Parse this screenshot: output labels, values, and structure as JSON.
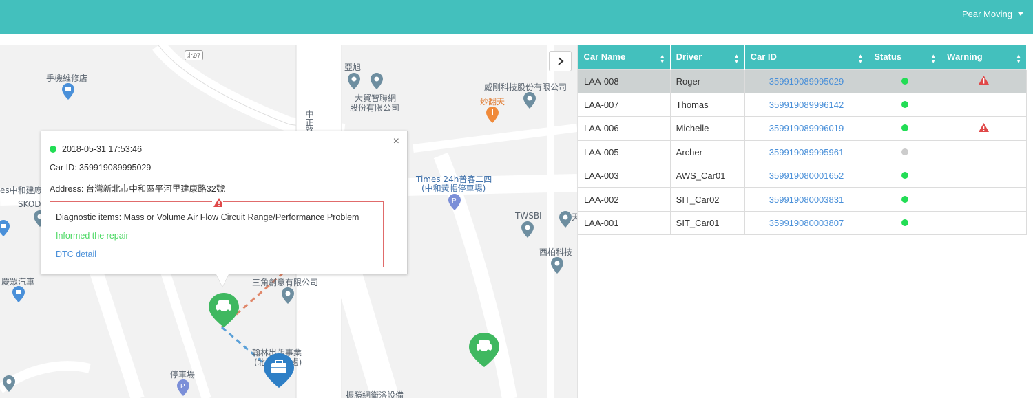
{
  "header": {
    "user_name": "Pear Moving",
    "color": "#43c0bd"
  },
  "map": {
    "labels": {
      "road_shield": "北97",
      "phone_shop": "手機維修店",
      "yaxu": "亞旭",
      "trade_net_1": "大貿智聯網",
      "trade_net_2": "股份有限公司",
      "weigang": "威剛科技股份有限公司",
      "chaofan": "炒翻天",
      "road_vertical": "中正路",
      "times_1": "Times 24h普客二四",
      "times_2": "(中和黃帽停車場)",
      "twsbi": "TWSBI",
      "xibo": "西柏科技",
      "sanjiao": "三角創意有限公司",
      "hanlin_1": "翰林出版事業",
      "hanlin_2": "(北區營運處)",
      "parking": "停車場",
      "zhensheng": "振勝網衛浴設備",
      "chunghe_left": "es中和建廠",
      "skoda": "SKOD",
      "qingzhong": "慶眾汽車",
      "partial_right": "天"
    }
  },
  "popup": {
    "datetime": "2018-05-31 17:53:46",
    "car_id": "Car ID: 359919089995029",
    "address": "Address: 台灣新北市中和區平河里建康路32號",
    "diagnostic": "Diagnostic items: Mass or Volume Air Flow Circuit Range/Performance Problem",
    "informed": "Informed the repair",
    "dtc_link": "DTC detail",
    "close_glyph": "×"
  },
  "table": {
    "columns": [
      "Car Name",
      "Driver",
      "Car ID",
      "Status",
      "Warning"
    ],
    "rows": [
      {
        "name": "LAA-008",
        "driver": "Roger",
        "car_id": "359919089995029",
        "status": "online",
        "warning": true
      },
      {
        "name": "LAA-007",
        "driver": "Thomas",
        "car_id": "359919089996142",
        "status": "online",
        "warning": false
      },
      {
        "name": "LAA-006",
        "driver": "Michelle",
        "car_id": "359919089996019",
        "status": "online",
        "warning": true
      },
      {
        "name": "LAA-005",
        "driver": "Archer",
        "car_id": "359919089995961",
        "status": "offline",
        "warning": false
      },
      {
        "name": "LAA-003",
        "driver": "AWS_Car01",
        "car_id": "359919080001652",
        "status": "online",
        "warning": false
      },
      {
        "name": "LAA-002",
        "driver": "SIT_Car02",
        "car_id": "359919080003831",
        "status": "online",
        "warning": false
      },
      {
        "name": "LAA-001",
        "driver": "SIT_Car01",
        "car_id": "359919080003807",
        "status": "online",
        "warning": false
      }
    ],
    "status_colors": {
      "online": "#22dd55",
      "offline": "#cccccc"
    },
    "warning_color": "#e04848"
  }
}
